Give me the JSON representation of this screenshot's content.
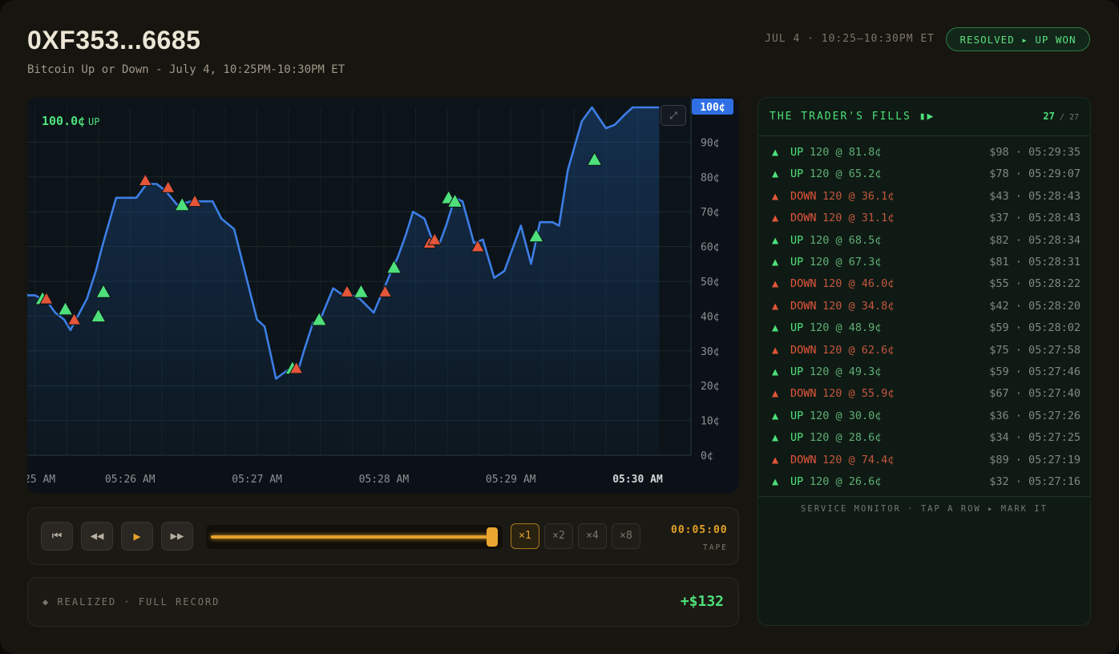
{
  "header": {
    "title": "0XF353...6685",
    "subtitle": "Bitcoin Up or Down - July 4, 10:25PM-10:30PM ET",
    "window": "JUL 4 · 10:25–10:30PM ET",
    "status": "RESOLVED ▸ UP WON"
  },
  "colors": {
    "up": "#4ee07a",
    "down": "#e4553a",
    "line": "#3d7ee6",
    "accent": "#e3a22a"
  },
  "chart": {
    "current_value": "100.0¢",
    "current_dir": "UP",
    "price_badge": "100¢",
    "expand_icon": "expand-icon"
  },
  "chart_data": {
    "type": "line",
    "ylim": [
      0,
      100
    ],
    "yticks": [
      "90¢",
      "80¢",
      "70¢",
      "60¢",
      "50¢",
      "40¢",
      "30¢",
      "20¢",
      "10¢",
      "0¢"
    ],
    "ytick_values": [
      90,
      80,
      70,
      60,
      50,
      40,
      30,
      20,
      10,
      0
    ],
    "xticks": [
      "25 AM",
      "05:26 AM",
      "05:27 AM",
      "05:28 AM",
      "05:29 AM",
      "05:30 AM"
    ],
    "xtick_minutes": [
      0,
      1,
      2,
      3,
      4,
      5
    ],
    "series": [
      {
        "x": [
          0,
          0.06,
          0.1,
          0.19,
          0.25,
          0.35,
          0.41,
          0.48,
          0.53,
          0.66,
          0.73,
          0.78,
          0.89,
          1.05,
          1.13,
          1.21,
          1.28,
          1.37,
          1.48,
          1.56,
          1.65,
          1.72,
          1.82,
          2.0,
          2.06,
          2.15,
          2.26,
          2.33,
          2.37,
          2.44,
          2.51,
          2.6,
          2.68,
          2.75,
          2.81,
          2.92,
          3.06,
          3.11,
          3.17,
          3.23,
          3.32,
          3.39,
          3.44,
          3.49,
          3.56,
          3.62,
          3.71,
          3.78,
          3.87,
          3.95,
          4.08,
          4.16,
          4.23,
          4.3,
          4.33,
          4.38,
          4.45,
          4.56,
          4.64,
          4.75,
          4.82,
          4.9,
          4.96,
          5.03,
          5.1,
          5.17
        ],
        "y": [
          52,
          52,
          51,
          46,
          46,
          44,
          41,
          39,
          36,
          45,
          53,
          60,
          74,
          74,
          78,
          78,
          76,
          72,
          73,
          73,
          73,
          68,
          65,
          39,
          37,
          22,
          25,
          25,
          30,
          38,
          40,
          48,
          46,
          46,
          45,
          41,
          53,
          57,
          63,
          70,
          68,
          61,
          61,
          66,
          74,
          73,
          61,
          62,
          51,
          53,
          66,
          55,
          67,
          67,
          67,
          66,
          82,
          96,
          100,
          94,
          95,
          98,
          100,
          100,
          100,
          100
        ]
      }
    ],
    "markers": [
      {
        "x": 0.12,
        "y": 52,
        "side": "DOWN"
      },
      {
        "x": 0.31,
        "y": 45,
        "side": "UP"
      },
      {
        "x": 0.34,
        "y": 45,
        "side": "DOWN"
      },
      {
        "x": 0.49,
        "y": 42,
        "side": "UP"
      },
      {
        "x": 0.56,
        "y": 39,
        "side": "DOWN"
      },
      {
        "x": 0.75,
        "y": 40,
        "side": "UP"
      },
      {
        "x": 0.79,
        "y": 47,
        "side": "UP"
      },
      {
        "x": 1.12,
        "y": 79,
        "side": "DOWN"
      },
      {
        "x": 1.3,
        "y": 77,
        "side": "DOWN"
      },
      {
        "x": 1.41,
        "y": 72,
        "side": "UP"
      },
      {
        "x": 1.51,
        "y": 73,
        "side": "DOWN"
      },
      {
        "x": 2.28,
        "y": 25,
        "side": "UP"
      },
      {
        "x": 2.31,
        "y": 25,
        "side": "DOWN"
      },
      {
        "x": 2.49,
        "y": 39,
        "side": "UP"
      },
      {
        "x": 2.71,
        "y": 47,
        "side": "DOWN"
      },
      {
        "x": 2.82,
        "y": 47,
        "side": "UP"
      },
      {
        "x": 3.01,
        "y": 47,
        "side": "DOWN"
      },
      {
        "x": 3.08,
        "y": 54,
        "side": "UP"
      },
      {
        "x": 3.36,
        "y": 61,
        "side": "DOWN"
      },
      {
        "x": 3.4,
        "y": 62,
        "side": "DOWN"
      },
      {
        "x": 3.51,
        "y": 74,
        "side": "UP"
      },
      {
        "x": 3.56,
        "y": 73,
        "side": "UP"
      },
      {
        "x": 3.74,
        "y": 60,
        "side": "DOWN"
      },
      {
        "x": 4.2,
        "y": 63,
        "side": "UP"
      },
      {
        "x": 4.66,
        "y": 85,
        "side": "UP"
      }
    ]
  },
  "player": {
    "buttons": [
      {
        "name": "skip-start-icon",
        "glyph": "⏮"
      },
      {
        "name": "rewind-icon",
        "glyph": "◀◀"
      },
      {
        "name": "play-icon",
        "glyph": "▶"
      },
      {
        "name": "fast-forward-icon",
        "glyph": "▶▶"
      }
    ],
    "progress": 1.0,
    "speeds": [
      "×1",
      "×2",
      "×4",
      "×8"
    ],
    "active_speed": 0,
    "time": "00:05:00",
    "tape_label": "TAPE"
  },
  "realized": {
    "label": "◆ REALIZED · FULL RECORD",
    "value": "+$132"
  },
  "fills": {
    "title": "THE TRADER'S FILLS ▮▶",
    "count_shown": "27",
    "count_sep": "/",
    "count_total": "27",
    "rows": [
      {
        "side": "UP",
        "qty": "120 @ 81.8¢",
        "meta": "$98 · 05:29:35"
      },
      {
        "side": "UP",
        "qty": "120 @ 65.2¢",
        "meta": "$78 · 05:29:07"
      },
      {
        "side": "DOWN",
        "qty": "120 @ 36.1¢",
        "meta": "$43 · 05:28:43"
      },
      {
        "side": "DOWN",
        "qty": "120 @ 31.1¢",
        "meta": "$37 · 05:28:43"
      },
      {
        "side": "UP",
        "qty": "120 @ 68.5¢",
        "meta": "$82 · 05:28:34"
      },
      {
        "side": "UP",
        "qty": "120 @ 67.3¢",
        "meta": "$81 · 05:28:31"
      },
      {
        "side": "DOWN",
        "qty": "120 @ 46.0¢",
        "meta": "$55 · 05:28:22"
      },
      {
        "side": "DOWN",
        "qty": "120 @ 34.8¢",
        "meta": "$42 · 05:28:20"
      },
      {
        "side": "UP",
        "qty": "120 @ 48.9¢",
        "meta": "$59 · 05:28:02"
      },
      {
        "side": "DOWN",
        "qty": "120 @ 62.6¢",
        "meta": "$75 · 05:27:58"
      },
      {
        "side": "UP",
        "qty": "120 @ 49.3¢",
        "meta": "$59 · 05:27:46"
      },
      {
        "side": "DOWN",
        "qty": "120 @ 55.9¢",
        "meta": "$67 · 05:27:40"
      },
      {
        "side": "UP",
        "qty": "120 @ 30.0¢",
        "meta": "$36 · 05:27:26"
      },
      {
        "side": "UP",
        "qty": "120 @ 28.6¢",
        "meta": "$34 · 05:27:25"
      },
      {
        "side": "DOWN",
        "qty": "120 @ 74.4¢",
        "meta": "$89 · 05:27:19"
      },
      {
        "side": "UP",
        "qty": "120 @ 26.6¢",
        "meta": "$32 · 05:27:16"
      }
    ],
    "monitor": "SERVICE MONITOR · TAP A ROW ▸ MARK IT"
  }
}
